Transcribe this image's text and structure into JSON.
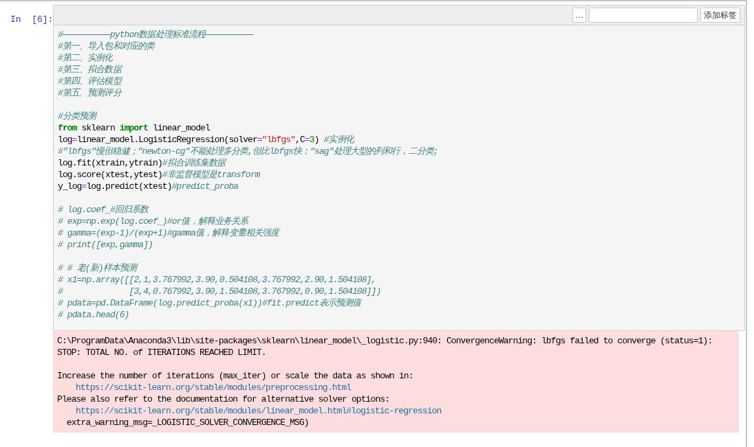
{
  "cell": {
    "prompt": "In  [6]:",
    "toolbar": {
      "more_button": "...",
      "add_tag_button": "添加标签"
    },
    "code_lines": [
      {
        "kind": "code",
        "segments": [
          {
            "kind": "comment",
            "text": "#——————————python数据处理标准流程——————————"
          }
        ]
      },
      {
        "kind": "code",
        "segments": [
          {
            "kind": "comment",
            "text": "#第一、导入包和对应的类"
          }
        ]
      },
      {
        "kind": "code",
        "segments": [
          {
            "kind": "comment",
            "text": "#第二、实例化"
          }
        ]
      },
      {
        "kind": "code",
        "segments": [
          {
            "kind": "comment",
            "text": "#第三、拟合数据"
          }
        ]
      },
      {
        "kind": "code",
        "segments": [
          {
            "kind": "comment",
            "text": "#第四、评估模型"
          }
        ]
      },
      {
        "kind": "code",
        "segments": [
          {
            "kind": "comment",
            "text": "#第五、预测评分"
          }
        ]
      },
      {
        "kind": "blank"
      },
      {
        "kind": "code",
        "segments": [
          {
            "kind": "comment",
            "text": "#分类预测"
          }
        ]
      },
      {
        "kind": "code",
        "segments": [
          {
            "kind": "keyword",
            "text": "from"
          },
          {
            "kind": "plain",
            "text": " sklearn "
          },
          {
            "kind": "keyword",
            "text": "import"
          },
          {
            "kind": "plain",
            "text": " linear_model"
          }
        ]
      },
      {
        "kind": "code",
        "segments": [
          {
            "kind": "plain",
            "text": "log"
          },
          {
            "kind": "operator",
            "text": "="
          },
          {
            "kind": "plain",
            "text": "linear_model.LogisticRegression(solver"
          },
          {
            "kind": "operator",
            "text": "="
          },
          {
            "kind": "string",
            "text": "\"lbfgs\""
          },
          {
            "kind": "plain",
            "text": ",C"
          },
          {
            "kind": "operator",
            "text": "="
          },
          {
            "kind": "number",
            "text": "3"
          },
          {
            "kind": "plain",
            "text": ") "
          },
          {
            "kind": "comment",
            "text": "#实例化"
          }
        ]
      },
      {
        "kind": "code",
        "segments": [
          {
            "kind": "comment",
            "text": "#\"lbfgs\"慢但稳健；\"newton-cg\"不能处理多分类,但比lbfgs快；\"sag\"处理大型的列和行，二分类;"
          }
        ]
      },
      {
        "kind": "code",
        "segments": [
          {
            "kind": "plain",
            "text": "log.fit(xtrain,ytrain)"
          },
          {
            "kind": "comment",
            "text": "#拟合训练集数据"
          }
        ]
      },
      {
        "kind": "code",
        "segments": [
          {
            "kind": "plain",
            "text": "log.score(xtest,ytest)"
          },
          {
            "kind": "comment",
            "text": "#非监督模型是transform"
          }
        ]
      },
      {
        "kind": "code",
        "segments": [
          {
            "kind": "plain",
            "text": "y_log"
          },
          {
            "kind": "operator",
            "text": "="
          },
          {
            "kind": "plain",
            "text": "log.predict(xtest)"
          },
          {
            "kind": "comment",
            "text": "#predict_proba"
          }
        ]
      },
      {
        "kind": "blank"
      },
      {
        "kind": "code",
        "segments": [
          {
            "kind": "comment",
            "text": "# log.coef_#回归系数"
          }
        ]
      },
      {
        "kind": "code",
        "segments": [
          {
            "kind": "comment",
            "text": "# exp=np.exp(log.coef_)#or值，解释业务关系"
          }
        ]
      },
      {
        "kind": "code",
        "segments": [
          {
            "kind": "comment",
            "text": "# gamma=(exp-1)/(exp+1)#gamma值，解释变量相关强度"
          }
        ]
      },
      {
        "kind": "code",
        "segments": [
          {
            "kind": "comment",
            "text": "# print([exp,gamma])"
          }
        ]
      },
      {
        "kind": "blank"
      },
      {
        "kind": "code",
        "segments": [
          {
            "kind": "comment",
            "text": "# # 老(新)样本预测"
          }
        ]
      },
      {
        "kind": "code",
        "segments": [
          {
            "kind": "comment",
            "text": "# x1=np.array([[2,1,3.767992,3.90,0.504108,3.767992,2.90,1.504108],"
          }
        ]
      },
      {
        "kind": "code",
        "segments": [
          {
            "kind": "comment",
            "text": "#              [3,4,0.767992,3.90,1.504108,3.767992,0.90,1.504108]])"
          }
        ]
      },
      {
        "kind": "code",
        "segments": [
          {
            "kind": "comment",
            "text": "# pdata=pd.DataFrame(log.predict_proba(x1))#fit.predict表示预测值"
          }
        ]
      },
      {
        "kind": "code",
        "segments": [
          {
            "kind": "comment",
            "text": "# pdata.head(6)"
          }
        ]
      }
    ],
    "output_lines": [
      {
        "kind": "text",
        "text": "C:\\ProgramData\\Anaconda3\\lib\\site-packages\\sklearn\\linear_model\\_logistic.py:940: ConvergenceWarning: lbfgs failed to converge (status=1):"
      },
      {
        "kind": "text",
        "text": "STOP: TOTAL NO. of ITERATIONS REACHED LIMIT."
      },
      {
        "kind": "blank"
      },
      {
        "kind": "text",
        "text": "Increase the number of iterations (max_iter) or scale the data as shown in:"
      },
      {
        "kind": "link",
        "text": "https://scikit-learn.org/stable/modules/preprocessing.html"
      },
      {
        "kind": "text",
        "text": "Please also refer to the documentation for alternative solver options:"
      },
      {
        "kind": "link",
        "text": "https://scikit-learn.org/stable/modules/linear_model.html#logistic-regression"
      },
      {
        "kind": "text",
        "text": "  extra_warning_msg=_LOGISTIC_SOLVER_CONVERGENCE_MSG)"
      }
    ]
  }
}
